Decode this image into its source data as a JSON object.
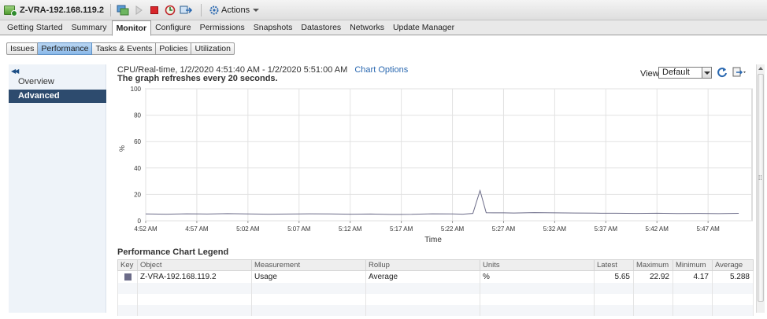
{
  "window": {
    "vm_name": "Z-VRA-192.168.119.2",
    "actions_label": "Actions"
  },
  "main_tabs": [
    "Getting Started",
    "Summary",
    "Monitor",
    "Configure",
    "Permissions",
    "Snapshots",
    "Datastores",
    "Networks",
    "Update Manager"
  ],
  "active_main_tab": "Monitor",
  "sub_tabs": [
    "Issues",
    "Performance",
    "Tasks & Events",
    "Policies",
    "Utilization"
  ],
  "active_sub_tab": "Performance",
  "left_nav": {
    "items": [
      "Overview",
      "Advanced"
    ],
    "active": "Advanced"
  },
  "chart_header": {
    "title": "CPU/Real-time, 1/2/2020 4:51:40 AM - 1/2/2020 5:51:00 AM",
    "options_link": "Chart Options",
    "refresh_note": "The graph refreshes every 20 seconds."
  },
  "view": {
    "label": "View:",
    "selected": "Default"
  },
  "colors": {
    "series": "#6b6b88",
    "accent": "#2a68b0",
    "nav_active": "#2d4b6e"
  },
  "chart_data": {
    "type": "line",
    "ylabel": "%",
    "xlabel": "Time",
    "ylim": [
      0,
      100
    ],
    "y_ticks": [
      "0",
      "20",
      "40",
      "60",
      "80",
      "100"
    ],
    "x_ticks": [
      "4:52 AM",
      "4:57 AM",
      "5:02 AM",
      "5:07 AM",
      "5:12 AM",
      "5:17 AM",
      "5:22 AM",
      "5:27 AM",
      "5:32 AM",
      "5:37 AM",
      "5:42 AM",
      "5:47 AM"
    ],
    "grid": true,
    "series": [
      {
        "x_minutes_from_4_52": [
          0,
          2,
          4,
          6,
          8,
          10,
          12,
          14,
          16,
          18,
          20,
          22,
          24,
          26,
          28,
          30,
          31,
          32,
          32.7,
          33.3,
          34,
          35,
          36,
          38,
          40,
          42,
          44,
          46,
          48,
          50,
          52,
          54,
          56,
          58
        ],
        "values": [
          5.2,
          5.0,
          5.3,
          5.1,
          5.4,
          5.2,
          5.0,
          5.1,
          5.3,
          5.2,
          5.0,
          5.1,
          4.8,
          4.9,
          5.3,
          5.2,
          5.0,
          5.6,
          22.9,
          6.1,
          6.0,
          6.0,
          5.9,
          6.2,
          6.0,
          5.9,
          5.8,
          5.7,
          5.6,
          5.7,
          5.5,
          5.6,
          5.4,
          5.65
        ]
      }
    ]
  },
  "legend": {
    "title": "Performance Chart Legend",
    "columns": [
      "Key",
      "Object",
      "Measurement",
      "Rollup",
      "Units",
      "Latest",
      "Maximum",
      "Minimum",
      "Average"
    ],
    "rows": [
      {
        "object": "Z-VRA-192.168.119.2",
        "measurement": "Usage",
        "rollup": "Average",
        "units": "%",
        "latest": "5.65",
        "maximum": "22.92",
        "minimum": "4.17",
        "average": "5.288"
      }
    ]
  }
}
